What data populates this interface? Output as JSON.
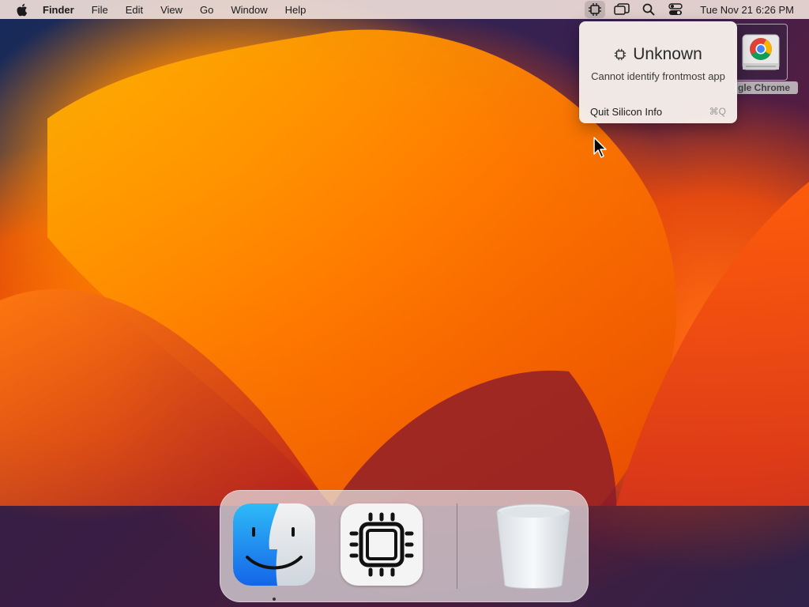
{
  "menubar": {
    "app_name": "Finder",
    "menus": [
      "File",
      "Edit",
      "View",
      "Go",
      "Window",
      "Help"
    ],
    "clock": "Tue Nov 21  6:26 PM"
  },
  "dropdown": {
    "title": "Unknown",
    "subtitle": "Cannot identify frontmost app",
    "quit_label": "Quit Silicon Info",
    "quit_shortcut": "⌘Q"
  },
  "desktop": {
    "icon_label": "gle Chrome"
  },
  "dock": {
    "apps": [
      "Finder",
      "Silicon Info",
      "Trash"
    ]
  },
  "colors": {
    "menubar_bg": "#ecdcd6",
    "accent_orange": "#ff6a00",
    "finder_blue": "#1e8bf0"
  }
}
